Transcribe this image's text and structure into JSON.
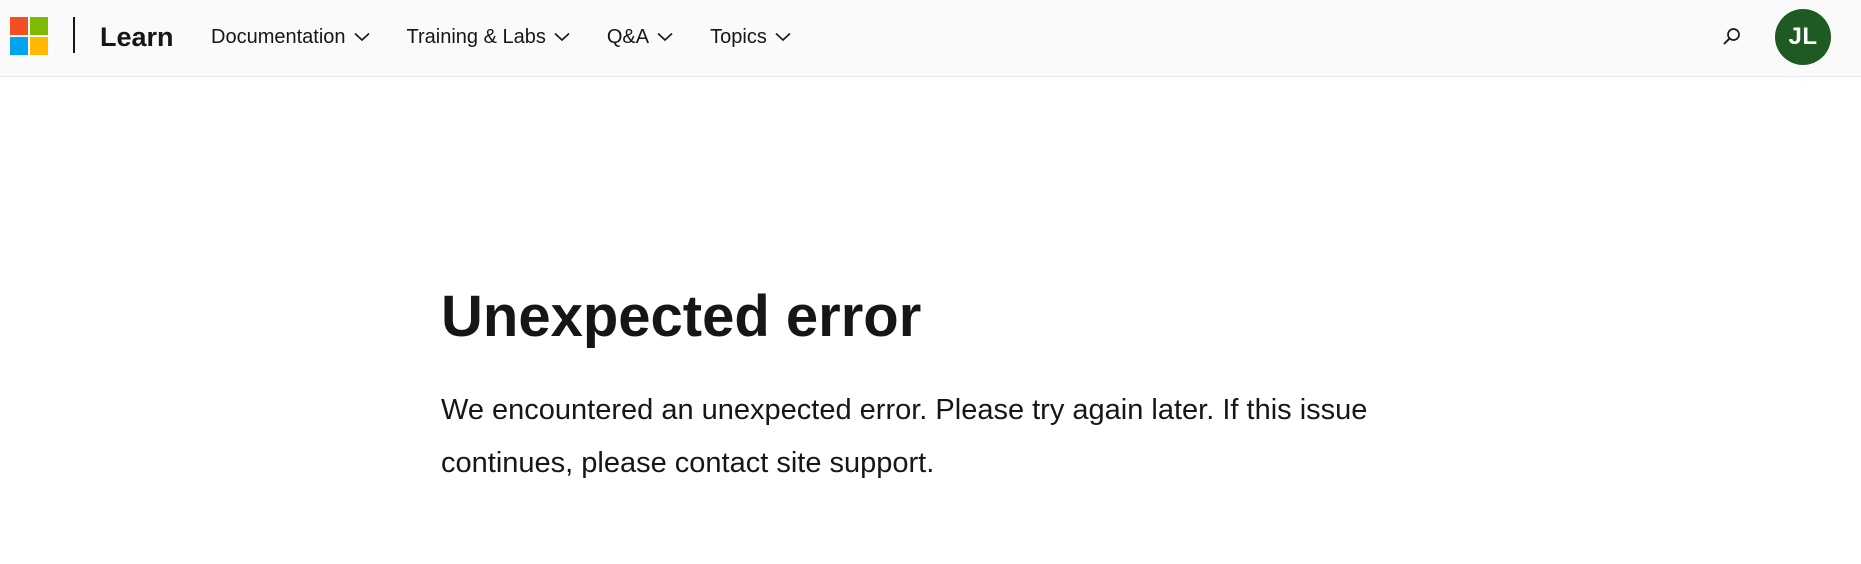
{
  "header": {
    "brand_name": "Learn",
    "nav_items": [
      {
        "label": "Documentation"
      },
      {
        "label": "Training & Labs"
      },
      {
        "label": "Q&A"
      },
      {
        "label": "Topics"
      }
    ],
    "avatar_initials": "JL",
    "logo_colors": [
      "#f25022",
      "#7fba00",
      "#00a4ef",
      "#ffb900"
    ],
    "avatar_color": "#1e5b23"
  },
  "main": {
    "title": "Unexpected error",
    "message": "We encountered an unexpected error. Please try again later. If this issue continues, please contact site support."
  },
  "icons": {
    "search": "search-icon",
    "chevron": "chevron-down-icon"
  }
}
